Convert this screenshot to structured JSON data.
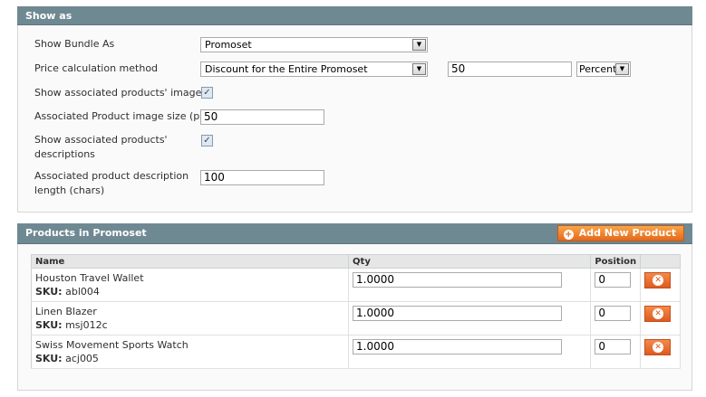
{
  "show_as": {
    "title": "Show as",
    "bundle_as": {
      "label": "Show Bundle As",
      "value": "Promoset"
    },
    "price_calc": {
      "label": "Price calculation method",
      "value": "Discount for the Entire Promoset",
      "amount": "50",
      "unit": "Percent"
    },
    "show_images": {
      "label": "Show associated products' images",
      "checked": true
    },
    "image_size": {
      "label": "Associated Product image size (px)",
      "value": "50"
    },
    "show_desc": {
      "label_line1": "Show associated products'",
      "label_line2": "descriptions",
      "checked": true
    },
    "desc_length": {
      "label_line1": "Associated product description",
      "label_line2": "length (chars)",
      "value": "100"
    }
  },
  "products": {
    "title": "Products in Promoset",
    "add_button": "Add New Product",
    "columns": {
      "name": "Name",
      "qty": "Qty",
      "position": "Position"
    },
    "sku_label": "SKU:",
    "rows": [
      {
        "name": "Houston Travel Wallet",
        "sku": "abl004",
        "qty": "1.0000",
        "position": "0"
      },
      {
        "name": "Linen Blazer",
        "sku": "msj012c",
        "qty": "1.0000",
        "position": "0"
      },
      {
        "name": "Swiss Movement Sports Watch",
        "sku": "acj005",
        "qty": "1.0000",
        "position": "0"
      }
    ]
  },
  "icons": {
    "dropdown": "dropdown-arrow-icon",
    "check": "checkmark-icon",
    "add": "plus-icon",
    "delete": "delete-x-icon"
  },
  "colors": {
    "section_header": "#6f8992",
    "button_orange": "#e4681b"
  }
}
